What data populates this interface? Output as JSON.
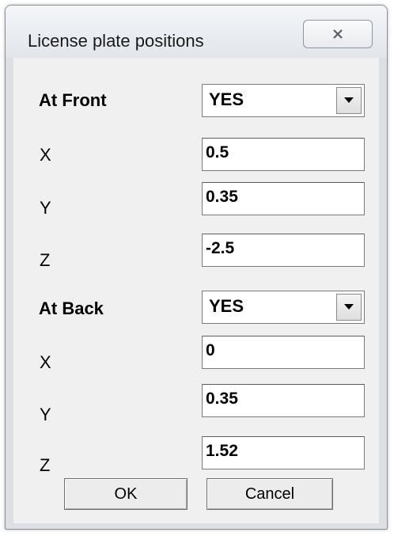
{
  "window": {
    "title": "License plate positions"
  },
  "front": {
    "label": "At Front",
    "value": "YES",
    "x_label": "X",
    "x": "0.5",
    "y_label": "Y",
    "y": "0.35",
    "z_label": "Z",
    "z": "-2.5"
  },
  "back": {
    "label": "At Back",
    "value": "YES",
    "x_label": "X",
    "x": "0",
    "y_label": "Y",
    "y": "0.35",
    "z_label": "Z",
    "z": "1.52"
  },
  "buttons": {
    "ok": "OK",
    "cancel": "Cancel"
  }
}
